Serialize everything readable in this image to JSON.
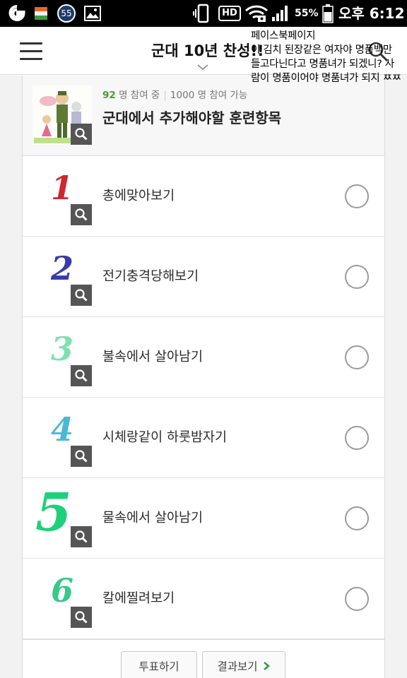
{
  "status_bar": {
    "battery_percent": "55%",
    "time": "오후 6:12",
    "notification_count": "55",
    "hd_label": "HD"
  },
  "header": {
    "title": "군대 10년 찬성!!"
  },
  "overlay_note": {
    "line1": "페이스북페이지",
    "line2": "이 김치 된장같은 여자야 명품백만 들고다닌다고 명품녀가 되겠니? 사람이 명품이어야 명품녀가 되지 ㅉㅉ"
  },
  "poll": {
    "participants_count": "92",
    "participants_suffix": "명 참여 중",
    "capacity_text": "1000 명 참여 가능",
    "question": "군대에서 추가해야할 훈련항목",
    "options": [
      {
        "number": "1",
        "label": "총에맞아보기",
        "color": "#d0262f"
      },
      {
        "number": "2",
        "label": "전기충격당해보기",
        "color": "#3a3aa8"
      },
      {
        "number": "3",
        "label": "불속에서 살아남기",
        "color": "#7fe0b0"
      },
      {
        "number": "4",
        "label": "시체랑같이 하룻밤자기",
        "color": "#49b8d6"
      },
      {
        "number": "5",
        "label": "물속에서 살아남기",
        "color": "#1ed07a"
      },
      {
        "number": "6",
        "label": "칼에찔려보기",
        "color": "#35c98a"
      }
    ]
  },
  "buttons": {
    "vote": "투표하기",
    "results": "결과보기"
  },
  "colors": {
    "accent_green": "#4a9d2c",
    "status_bar_bg": "#000000"
  }
}
